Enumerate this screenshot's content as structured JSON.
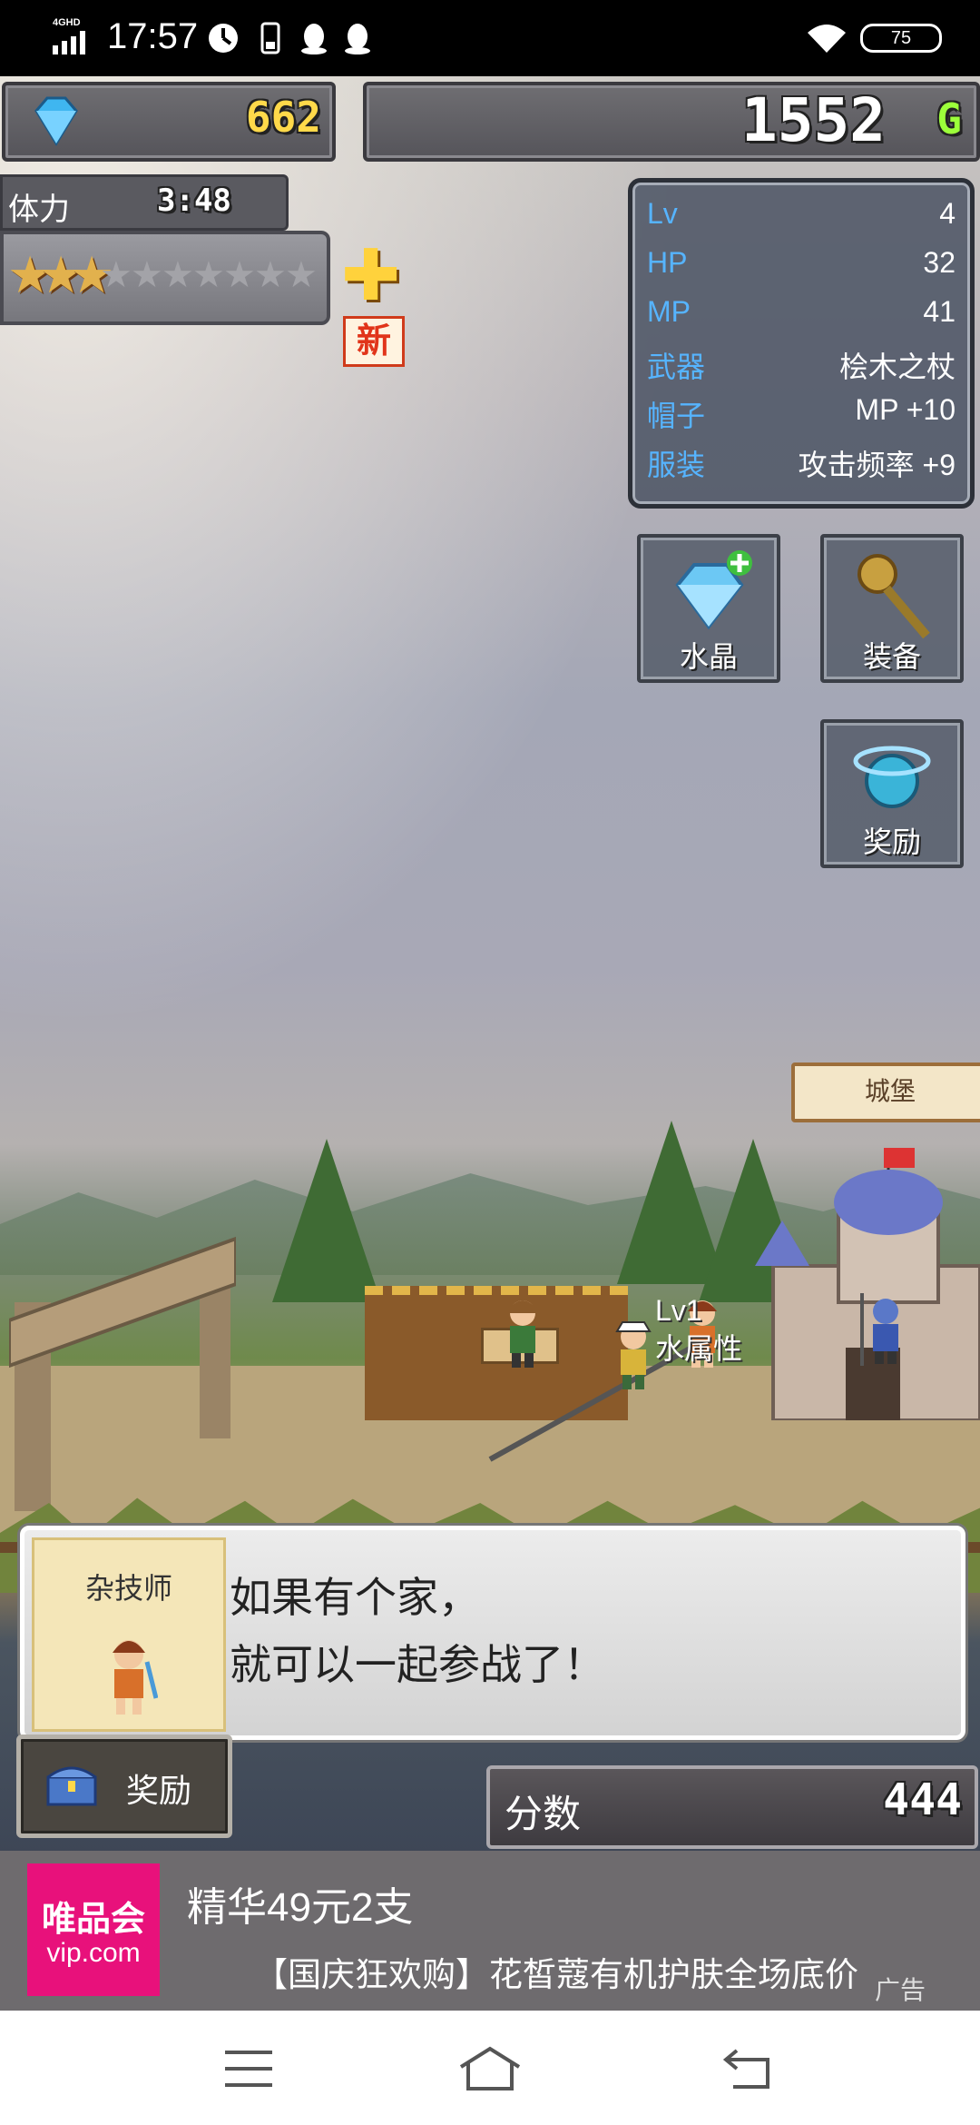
{
  "status_bar": {
    "network": "4GHD",
    "time": "17:57",
    "battery": "75"
  },
  "hud": {
    "gems": "662",
    "gold": "1552",
    "gold_unit": "G",
    "stamina_label": "体力",
    "stamina_timer": "3:48",
    "stars_filled": 3,
    "stars_total": 10,
    "new_badge": "新"
  },
  "stats": [
    {
      "key": "Lv",
      "value": "4"
    },
    {
      "key": "HP",
      "value": "32"
    },
    {
      "key": "MP",
      "value": "41"
    },
    {
      "key": "武器",
      "value": "桧木之杖"
    },
    {
      "key": "帽子",
      "value": "MP +10"
    },
    {
      "key": "服装",
      "value": "攻击频率 +9"
    }
  ],
  "buttons": {
    "crystal": "水晶",
    "equipment": "装备",
    "reward_top": "奖励"
  },
  "scene": {
    "castle_sign": "城堡",
    "char_level": "Lv1",
    "char_attr": "水属性"
  },
  "dialog": {
    "speaker": "杂技师",
    "line1": "如果有个家，",
    "line2": "就可以一起参战了！"
  },
  "bottom": {
    "reward_label": "奖励",
    "score_label": "分数",
    "score_value": "444"
  },
  "ad": {
    "logo_cn": "唯品会",
    "logo_en": "vip.com",
    "title": "精华49元2支",
    "desc": "【国庆狂欢购】花皙蔻有机护肤全场底价",
    "mark": "广告"
  },
  "colors": {
    "stat_key": "#56b4ff",
    "gem_count": "#ffd94a",
    "gold_unit": "#9cff3a",
    "ad_logo": "#e8117b"
  }
}
